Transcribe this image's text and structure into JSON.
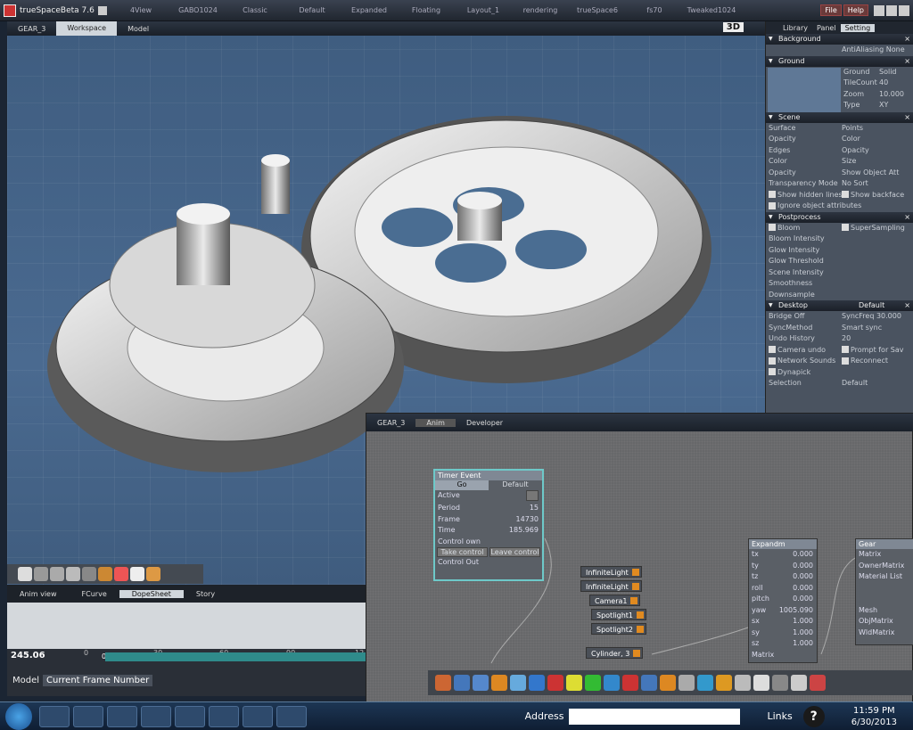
{
  "app": {
    "title": "trueSpaceBeta 7.6",
    "tabs": [
      "4View",
      "GABO1024",
      "Classic",
      "Default",
      "Expanded",
      "Floating",
      "Layout_1",
      "rendering",
      "trueSpace6",
      "fs70",
      "Tweaked1024"
    ],
    "buttons": [
      "File",
      "Help"
    ]
  },
  "viewport": {
    "title": "GEAR_3",
    "tabs": [
      "Workspace",
      "Model"
    ],
    "badge": "3D"
  },
  "settings_panel": {
    "tabs": [
      "Library",
      "Panel",
      "Setting"
    ],
    "background": {
      "header": "Background",
      "right": "AntiAliasing None"
    },
    "ground": {
      "header": "Ground",
      "rows": [
        [
          "Ground",
          "Solid"
        ],
        [
          "TileCount",
          "40"
        ],
        [
          "Zoom",
          "10.000"
        ],
        [
          "Type",
          "XY"
        ]
      ]
    },
    "scene": {
      "header": "Scene",
      "rows": [
        [
          "Surface",
          "Points"
        ],
        [
          "Opacity",
          "Color"
        ],
        [
          "Edges",
          "Opacity"
        ],
        [
          "Color",
          "Size"
        ],
        [
          "Opacity",
          "Show Object Att"
        ],
        [
          "Transparency Mode",
          "No Sort"
        ],
        [
          "Show hidden lines",
          "Show backface"
        ],
        [
          "Ignore object attributes",
          ""
        ]
      ]
    },
    "postprocess": {
      "header": "Postprocess",
      "rows": [
        [
          "Bloom",
          "SuperSampling"
        ],
        [
          "Bloom Intensity",
          ""
        ],
        [
          "Glow Intensity",
          ""
        ],
        [
          "Glow Threshold",
          ""
        ],
        [
          "Scene Intensity",
          ""
        ],
        [
          "Smoothness",
          ""
        ],
        [
          "Downsample",
          ""
        ]
      ]
    },
    "desktop": {
      "header": "Desktop",
      "right": "Default",
      "rows": [
        [
          "Bridge Off",
          "SyncFreq 30.000"
        ],
        [
          "SyncMethod",
          "Smart sync"
        ],
        [
          "Undo History",
          "20"
        ],
        [
          "Camera undo",
          "Prompt for Sav"
        ],
        [
          "Network Sounds",
          "Reconnect"
        ],
        [
          "Dynapick",
          ""
        ],
        [
          "Selection",
          "Default"
        ]
      ]
    }
  },
  "anim_panel": {
    "tabs": [
      "Anim view",
      "FCurve",
      "DopeSheet",
      "Story"
    ],
    "ruler": [
      "0",
      "30",
      "60",
      "90",
      "12"
    ],
    "time": "245.06",
    "ruler_start": "0",
    "model_label": "Model",
    "model_value": "Current Frame Number"
  },
  "link_editor": {
    "title": "GEAR_3",
    "tabs": [
      "Anim",
      "Developer"
    ],
    "timer": {
      "title": "Timer Event",
      "tabs": [
        "Go",
        "Default"
      ],
      "rows": [
        [
          "Active",
          ""
        ],
        [
          "Period",
          "15"
        ],
        [
          "Frame",
          "14730"
        ],
        [
          "Time",
          "185.969"
        ],
        [
          "Control own",
          ""
        ]
      ],
      "buttons": [
        "Take control",
        "Leave control"
      ],
      "footer": "Control Out"
    },
    "pills": [
      "InfiniteLight",
      "InfiniteLight",
      "Camera1",
      "Spotlight1",
      "Spotlight2",
      "Cylinder, 3"
    ],
    "expand": {
      "title": "Expandm",
      "rows": [
        [
          "tx",
          "0.000"
        ],
        [
          "ty",
          "0.000"
        ],
        [
          "tz",
          "0.000"
        ],
        [
          "roll",
          "0.000"
        ],
        [
          "pitch",
          "0.000"
        ],
        [
          "yaw",
          "1005.090"
        ],
        [
          "sx",
          "1.000"
        ],
        [
          "sy",
          "1.000"
        ],
        [
          "sz",
          "1.000"
        ],
        [
          "Matrix",
          ""
        ]
      ]
    },
    "gear": {
      "title": "Gear",
      "rows": [
        "Matrix",
        "OwnerMatrix",
        "Material List",
        "",
        "",
        "Mesh",
        "ObjMatrix",
        "WldMatrix"
      ]
    }
  },
  "taskbar": {
    "address_label": "Address",
    "links_label": "Links",
    "help": "?",
    "time": "11:59 PM",
    "date": "6/30/2013"
  }
}
